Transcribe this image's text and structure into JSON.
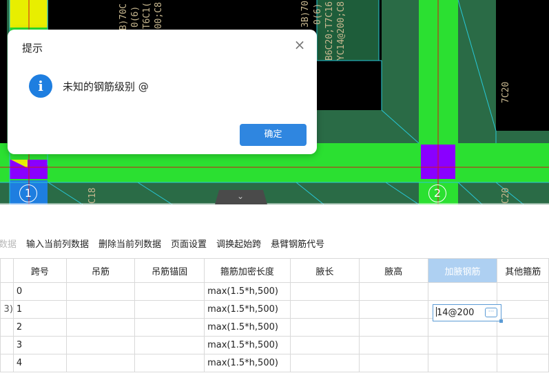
{
  "cad": {
    "annotations": [
      "3B)70C",
      "0(6)",
      ";T6C1(",
      "200;C8",
      "3B)70",
      "0(6)",
      "B6C20;T7C16",
      "YC14@200;C8",
      "7C20",
      "C18",
      "C20"
    ],
    "axis_labels": [
      "1",
      "2"
    ],
    "collapse_icon": "chevron-down-icon",
    "collapse_glyph": "⌄"
  },
  "toolbar": {
    "items": [
      "数据",
      "输入当前列数据",
      "删除当前列数据",
      "页面设置",
      "调换起始跨",
      "悬臂钢筋代号"
    ]
  },
  "grid": {
    "headers": [
      "跨号",
      "吊筋",
      "吊筋锚固",
      "箍筋加密长度",
      "腋长",
      "腋高",
      "加腋钢筋",
      "其他箍筋"
    ],
    "rows": [
      {
        "span": "0",
        "stirrup_len": "max(1.5*h,500)"
      },
      {
        "rowhdr": "3)",
        "span": "1",
        "stirrup_len": "max(1.5*h,500)"
      },
      {
        "span": "2",
        "stirrup_len": "max(1.5*h,500)"
      },
      {
        "span": "3",
        "stirrup_len": "max(1.5*h,500)"
      },
      {
        "span": "4",
        "stirrup_len": "max(1.5*h,500)"
      }
    ],
    "editing_value": "14@200",
    "more_glyph": "···"
  },
  "dialog": {
    "title": "提示",
    "close_glyph": "×",
    "info_glyph": "i",
    "message": "未知的钢筋级别 @",
    "ok_label": "确定"
  },
  "colors": {
    "bright_green": "#2be031",
    "dark_green": "#2a6b46",
    "purple": "#8a00ff",
    "accent_blue": "#2f86e0"
  }
}
